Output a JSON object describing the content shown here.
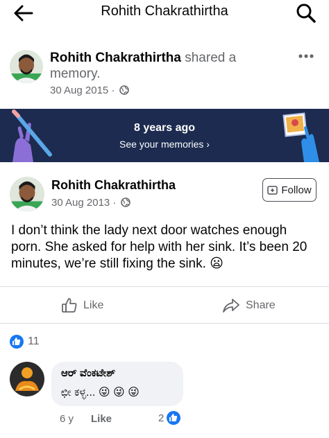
{
  "topbar": {
    "title": "Rohith Chakrathirtha"
  },
  "memory_post": {
    "author": "Rohith Chakrathirtha",
    "action_text": "shared a memory.",
    "date": "30 Aug 2015",
    "dot": "·"
  },
  "banner": {
    "years_text": "8 years ago",
    "see_text": "See your memories ›",
    "background_color": "#1c2b4f"
  },
  "original_post": {
    "author": "Rohith Chakrathirtha",
    "date": "30 Aug 2013",
    "dot": "·",
    "follow_label": "Follow",
    "body": "I don’t think the lady next door watches enough porn. She asked for help with her sink. It’s been 20 minutes, we’re still fixing the sink. 😦"
  },
  "actions": {
    "like_label": "Like",
    "share_label": "Share"
  },
  "reactions": {
    "count": "11"
  },
  "comment": {
    "author": "ಆರ್ ವೆಂಕಟೇಶ್",
    "text": "ಛೀ ಕಳ್ಳ... 😜 😜 😜",
    "age": "6 y",
    "like_label": "Like",
    "like_count": "2"
  },
  "colors": {
    "accent": "#1877f2",
    "muted": "#65676b"
  }
}
